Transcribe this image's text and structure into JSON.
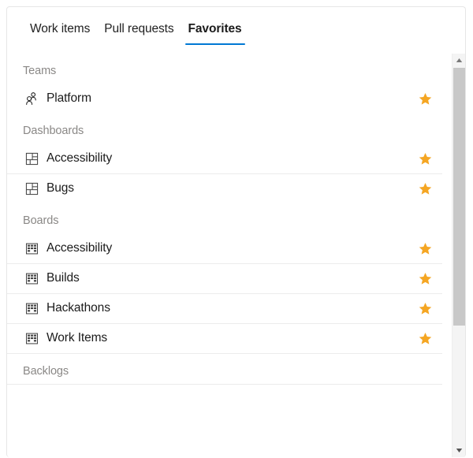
{
  "tabs": [
    {
      "label": "Work items",
      "selected": false
    },
    {
      "label": "Pull requests",
      "selected": false
    },
    {
      "label": "Favorites",
      "selected": true
    }
  ],
  "colors": {
    "accent": "#0078d4",
    "star": "#f5a623",
    "section_header": "#8a8886",
    "label": "#1b1b1b",
    "separator": "#ececec",
    "scrollbar_track": "#f4f4f4",
    "scrollbar_thumb": "#c8c8c8"
  },
  "sections": [
    {
      "header": "Teams",
      "items": [
        {
          "label": "Platform",
          "icon": "team-icon",
          "favorited": true
        }
      ]
    },
    {
      "header": "Dashboards",
      "items": [
        {
          "label": "Accessibility",
          "icon": "dashboard-icon",
          "favorited": true
        },
        {
          "label": "Bugs",
          "icon": "dashboard-icon",
          "favorited": true
        }
      ]
    },
    {
      "header": "Boards",
      "items": [
        {
          "label": "Accessibility",
          "icon": "board-icon",
          "favorited": true
        },
        {
          "label": "Builds",
          "icon": "board-icon",
          "favorited": true
        },
        {
          "label": "Hackathons",
          "icon": "board-icon",
          "favorited": true
        },
        {
          "label": "Work Items",
          "icon": "board-icon",
          "favorited": true
        }
      ]
    },
    {
      "header": "Backlogs",
      "items": []
    }
  ],
  "scrollbar": {
    "up_arrow": "scroll-up-arrow",
    "down_arrow": "scroll-down-arrow",
    "thumb": "scrollbar-thumb"
  }
}
